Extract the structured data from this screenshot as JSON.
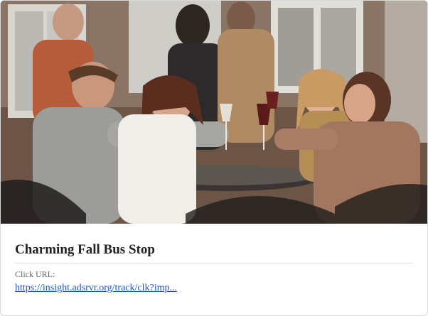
{
  "card": {
    "title": "Charming Fall Bus Stop",
    "url_label": "Click URL:",
    "url_text": "https://insight.adsrvr.org/track/clk?imp..."
  },
  "photo": {
    "subject": "friends-toasting-wine-outdoor-cafe"
  },
  "colors": {
    "title": "#222222",
    "link": "#1a56c8",
    "label": "#666666"
  }
}
